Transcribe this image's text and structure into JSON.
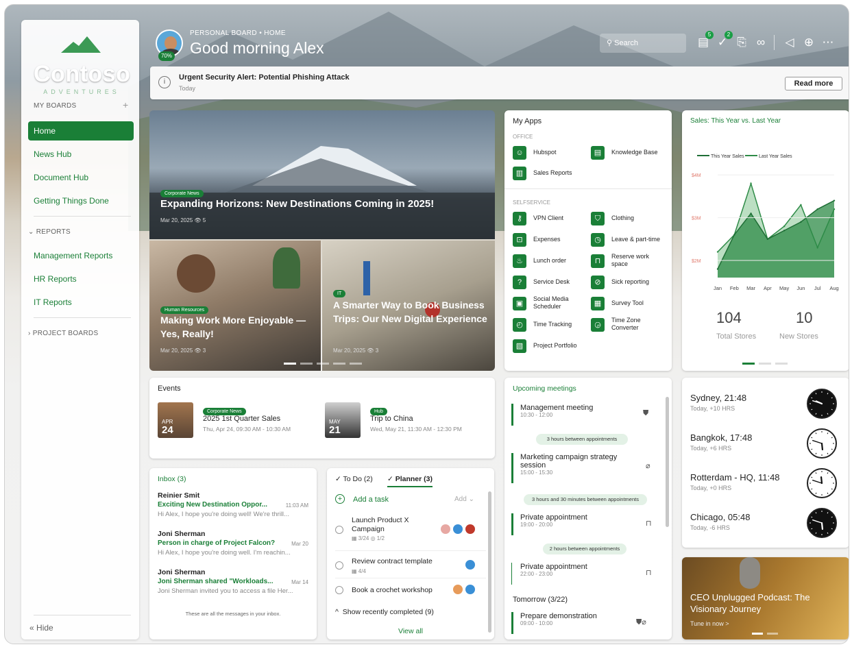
{
  "header": {
    "breadcrumb": "PERSONAL BOARD  •  HOME",
    "greeting": "Good morning Alex",
    "avatar_progress": "70%",
    "search_placeholder": "Search",
    "badges": {
      "tasks": "5",
      "approvals": "2"
    }
  },
  "brand": {
    "name": "Contoso",
    "tagline": "ADVENTURES"
  },
  "sidebar": {
    "my_boards_label": "MY BOARDS",
    "items": [
      "Home",
      "News Hub",
      "Document Hub",
      "Getting Things Done"
    ],
    "reports_label": "REPORTS",
    "report_items": [
      "Management Reports",
      "HR Reports",
      "IT Reports"
    ],
    "project_boards_label": "PROJECT BOARDS",
    "hide_label": "Hide"
  },
  "alert": {
    "title": "Urgent Security Alert: Potential Phishing Attack",
    "date": "Today",
    "button": "Read more"
  },
  "news": {
    "main": {
      "tag": "Corporate News",
      "title": "Expanding Horizons: New Destinations Coming in 2025!",
      "meta": "Mar 20, 2025  👁 5"
    },
    "left": {
      "tag": "Human Resources",
      "title": "Making Work More Enjoyable —Yes, Really!",
      "meta": "Mar 20, 2025  👁 3"
    },
    "right": {
      "tag": "IT",
      "title": "A Smarter Way to Book Business Trips: Our New Digital Experience",
      "meta": "Mar 20, 2025  👁 3"
    }
  },
  "apps": {
    "title": "My Apps",
    "office_label": "OFFICE",
    "office": [
      "Hubspot",
      "Knowledge Base",
      "Sales Reports"
    ],
    "selfservice_label": "SELFSERVICE",
    "selfservice": [
      "VPN Client",
      "Clothing",
      "Expenses",
      "Leave & part-time",
      "Lunch order",
      "Reserve work space",
      "Service Desk",
      "Sick reporting",
      "Social Media Scheduler",
      "Survey Tool",
      "Time Tracking",
      "Time Zone Converter",
      "Project Portfolio"
    ]
  },
  "sales": {
    "title": "Sales: This Year vs. Last Year",
    "total_stores_value": "104",
    "total_stores_label": "Total Stores",
    "new_stores_value": "10",
    "new_stores_label": "New Stores"
  },
  "chart_data": {
    "type": "area",
    "categories": [
      "Jan",
      "Feb",
      "Mar",
      "Apr",
      "May",
      "Jun",
      "Jul",
      "Aug"
    ],
    "series": [
      {
        "name": "This Year Sales",
        "values": [
          1.8,
          2.6,
          3.1,
          2.5,
          2.7,
          2.9,
          3.2,
          3.4
        ]
      },
      {
        "name": "Last Year Sales",
        "values": [
          2.2,
          2.6,
          3.8,
          2.5,
          2.8,
          3.3,
          2.3,
          3.2
        ]
      }
    ],
    "yticks": [
      "$2M",
      "$3M",
      "$4M"
    ],
    "ylim": [
      1.6,
      4.1
    ],
    "legend": "top"
  },
  "events": {
    "title": "Events",
    "items": [
      {
        "month": "APR",
        "day": "24",
        "tag": "Corporate News",
        "name": "2025 1st Quarter Sales",
        "when": "Thu, Apr 24, 09:30 AM - 10:30 AM"
      },
      {
        "month": "MAY",
        "day": "21",
        "tag": "Hub",
        "name": "Trip to China",
        "when": "Wed, May 21, 11:30 AM - 12:30 PM"
      }
    ]
  },
  "meetings": {
    "title": "Upcoming meetings",
    "items": [
      {
        "name": "Management meeting",
        "time": "10:30 - 12:00"
      },
      {
        "name": "Marketing campaign strategy session",
        "time": "15:00 - 15:30"
      },
      {
        "name": "Private appointment",
        "time": "19:00 - 20:00"
      },
      {
        "name": "Private appointment",
        "time": "22:00 - 23:00"
      }
    ],
    "gaps": [
      "3 hours between appointments",
      "3 hours and 30 minutes between appointments",
      "2 hours between appointments"
    ],
    "tomorrow_label": "Tomorrow (3/22)",
    "tomorrow": {
      "name": "Prepare demonstration",
      "time": "09:00 - 10:00"
    }
  },
  "clocks": [
    {
      "city": "Sydney, 21:48",
      "offset": "Today, +10 HRS",
      "dark": true,
      "h": 21.8,
      "m": 48
    },
    {
      "city": "Bangkok, 17:48",
      "offset": "Today, +6 HRS",
      "dark": false,
      "h": 17.8,
      "m": 48
    },
    {
      "city": "Rotterdam - HQ, 11:48",
      "offset": "Today, +0 HRS",
      "dark": false,
      "h": 11.8,
      "m": 48
    },
    {
      "city": "Chicago, 05:48",
      "offset": "Today, -6 HRS",
      "dark": true,
      "h": 5.8,
      "m": 48
    }
  ],
  "inbox": {
    "title": "Inbox (3)",
    "messages": [
      {
        "from": "Reinier Smit",
        "subject": "Exciting New Destination Oppor...",
        "date": "11:03 AM",
        "preview": "Hi Alex, I hope you're doing well! We're thrill..."
      },
      {
        "from": "Joni Sherman",
        "subject": "Person in charge of Project Falcon?",
        "date": "Mar 20",
        "preview": "Hi Alex, I hope you're doing well. I'm reachin..."
      },
      {
        "from": "Joni Sherman",
        "subject": "Joni Sherman shared \"Workloads...",
        "date": "Mar 14",
        "preview": "Joni Sherman invited you to access a file Her..."
      }
    ],
    "footer": "These are all the messages in your inbox."
  },
  "todo": {
    "tab_todo": "To Do (2)",
    "tab_planner": "Planner (3)",
    "add_task": "Add a task",
    "add": "Add",
    "tasks": [
      {
        "name": "Launch Product X Campaign",
        "meta": "3/24",
        "meta2": "1/2"
      },
      {
        "name": "Review contract template",
        "meta": "4/4"
      },
      {
        "name": "Book a crochet workshop"
      }
    ],
    "show_completed": "Show recently completed (9)",
    "view_all": "View all"
  },
  "podcast": {
    "title": "CEO Unplugged Podcast: The Visionary Journey",
    "cta": "Tune in now >"
  },
  "colors": {
    "accent": "#1a7f37",
    "tag_bg": "#1a7f37"
  }
}
